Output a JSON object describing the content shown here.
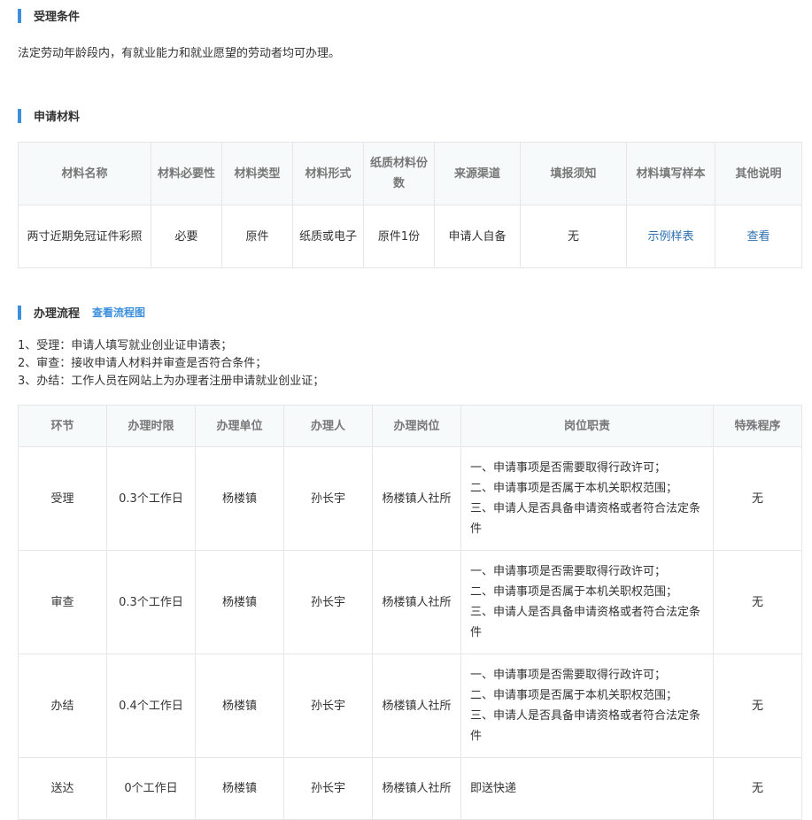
{
  "conditions": {
    "title": "受理条件",
    "text": "法定劳动年龄段内，有就业能力和就业愿望的劳动者均可办理。"
  },
  "materials": {
    "title": "申请材料",
    "headers": [
      "材料名称",
      "材料必要性",
      "材料类型",
      "材料形式",
      "纸质材料份数",
      "来源渠道",
      "填报须知",
      "材料填写样本",
      "其他说明"
    ],
    "rows": [
      [
        "两寸近期免冠证件彩照",
        "必要",
        "原件",
        "纸质或电子",
        "原件1份",
        "申请人自备",
        "无",
        "示例样表",
        "查看"
      ]
    ]
  },
  "process": {
    "title": "办理流程",
    "link": "查看流程图",
    "steps": [
      "1、受理：申请人填写就业创业证申请表；",
      "2、审查：接收申请人材料并审查是否符合条件；",
      "3、办结：工作人员在网站上为办理者注册申请就业创业证；"
    ],
    "headers": [
      "环节",
      "办理时限",
      "办理单位",
      "办理人",
      "办理岗位",
      "岗位职责",
      "特殊程序"
    ],
    "rows": [
      [
        "受理",
        "0.3个工作日",
        "杨楼镇",
        "孙长宇",
        "杨楼镇人社所",
        [
          "一、申请事项是否需要取得行政许可；",
          "二、申请事项是否属于本机关职权范围；",
          "三、申请人是否具备申请资格或者符合法定条件"
        ],
        "无"
      ],
      [
        "审查",
        "0.3个工作日",
        "杨楼镇",
        "孙长宇",
        "杨楼镇人社所",
        [
          "一、申请事项是否需要取得行政许可；",
          "二、申请事项是否属于本机关职权范围；",
          "三、申请人是否具备申请资格或者符合法定条件"
        ],
        "无"
      ],
      [
        "办结",
        "0.4个工作日",
        "杨楼镇",
        "孙长宇",
        "杨楼镇人社所",
        [
          "一、申请事项是否需要取得行政许可；",
          "二、申请事项是否属于本机关职权范围；",
          "三、申请人是否具备申请资格或者符合法定条件"
        ],
        "无"
      ],
      [
        "送达",
        "0个工作日",
        "杨楼镇",
        "孙长宇",
        "杨楼镇人社所",
        [
          "即送快递"
        ],
        "无"
      ]
    ]
  },
  "colors": {
    "accent": "#3c8fdc",
    "link": "#2c6fb1",
    "border": "#e6e6e6",
    "header_bg": "#f7fafa"
  }
}
